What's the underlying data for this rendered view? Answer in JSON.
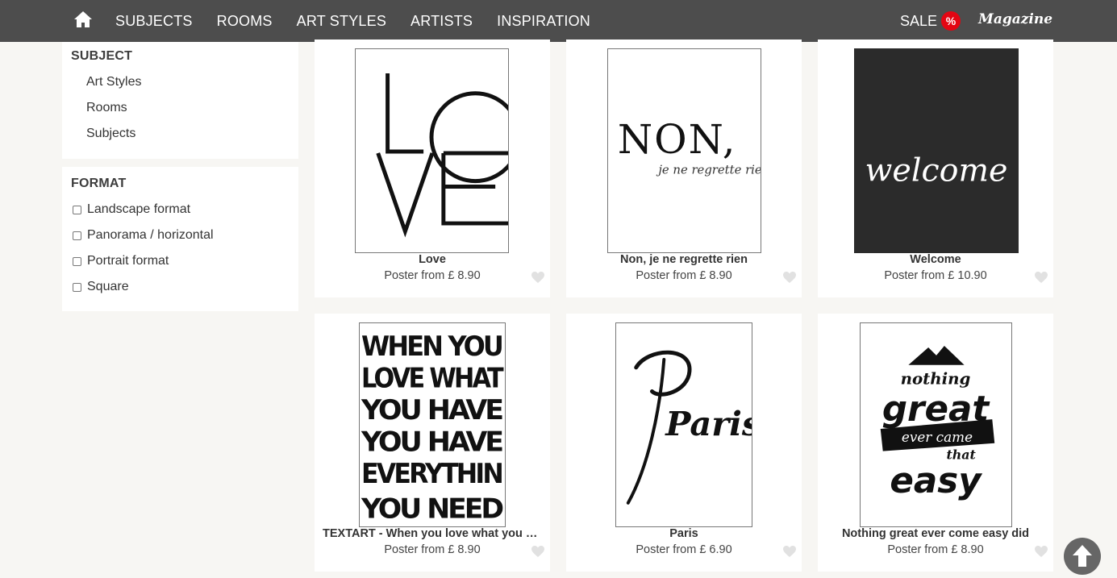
{
  "nav": {
    "home_icon": "home-icon",
    "items": [
      "SUBJECTS",
      "ROOMS",
      "ART STYLES",
      "ARTISTS",
      "INSPIRATION"
    ],
    "sale_label": "SALE",
    "sale_badge": "%",
    "magazine_label": "Magazine"
  },
  "sidebar": {
    "subject": {
      "title": "SUBJECT",
      "links": [
        "Art Styles",
        "Rooms",
        "Subjects"
      ]
    },
    "format": {
      "title": "FORMAT",
      "options": [
        "Landscape format",
        "Panorama / horizontal",
        "Portrait format",
        "Square"
      ]
    }
  },
  "products": [
    {
      "title": "Love",
      "price": "Poster from £ 8.90",
      "art_text": [
        "L",
        "O",
        "V",
        "E"
      ]
    },
    {
      "title": "Non, je ne regrette rien",
      "price": "Poster from £ 8.90",
      "art_text": [
        "NON,",
        "je ne regrette rien"
      ]
    },
    {
      "title": "Welcome",
      "price": "Poster from £ 10.90",
      "art_text": [
        "welcome"
      ]
    },
    {
      "title": "TEXTART - When you love what you h...",
      "price": "Poster from £ 8.90",
      "art_text": [
        "WHEN YOU",
        "LOVE WHAT",
        "YOU HAVE",
        "YOU HAVE",
        "EVERYTHIN",
        "YOU NEED"
      ]
    },
    {
      "title": "Paris",
      "price": "Poster from £ 6.90",
      "art_text": [
        "Paris"
      ]
    },
    {
      "title": "Nothing great ever come easy did",
      "price": "Poster from £ 8.90",
      "art_text": [
        "nothing",
        "great",
        "ever came",
        "that",
        "easy"
      ]
    }
  ],
  "icons": {
    "favorite": "heart-icon",
    "scroll_top": "arrow-up-icon"
  },
  "colors": {
    "topbar": "#4d4d4d",
    "sale_badge": "#e30613",
    "background": "#f7f6f3"
  }
}
